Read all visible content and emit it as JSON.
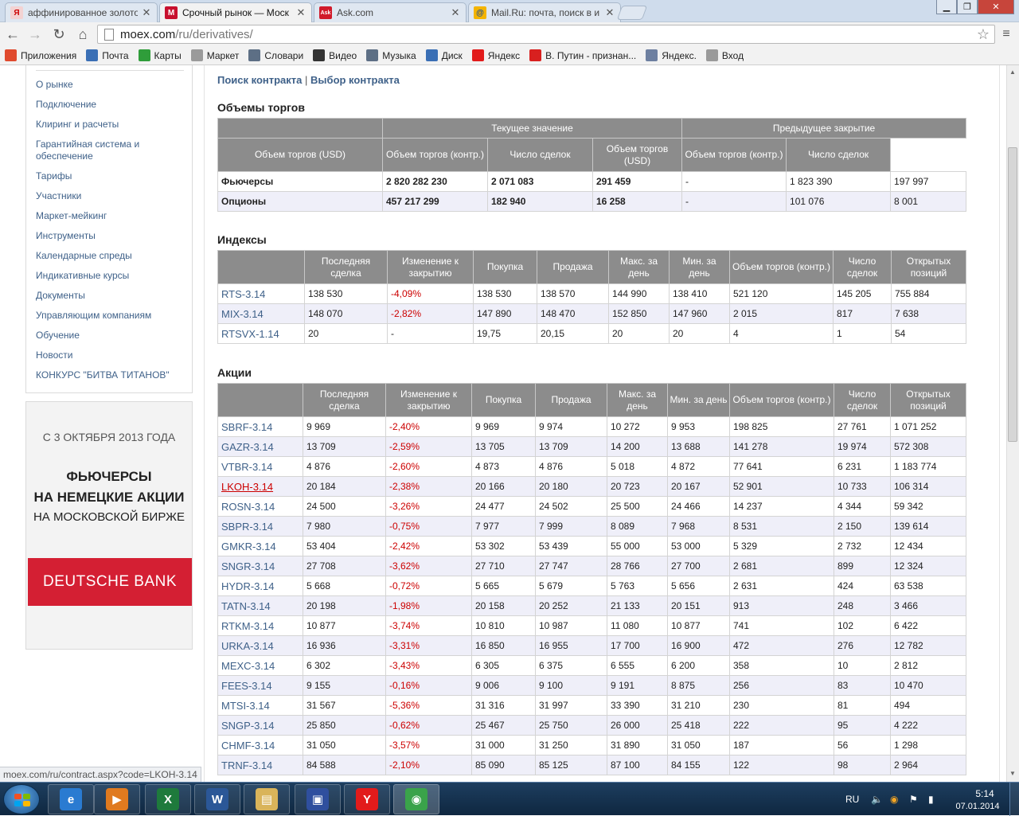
{
  "browser": {
    "tabs": [
      {
        "title": "аффинированное золото",
        "icon_text": "Я",
        "icon_color": "#e8c4c4"
      },
      {
        "title": "Срочный рынок — Моск",
        "icon_text": "М",
        "icon_color": "#c8102e"
      },
      {
        "title": "Ask.com",
        "icon_text": "Ask",
        "icon_color": "#d11a2a"
      },
      {
        "title": "Mail.Ru: почта, поиск в и",
        "icon_text": "@",
        "icon_color": "#1f6fb8"
      }
    ],
    "url_host": "moex.com",
    "url_path": "/ru/derivatives/",
    "bookmarks": [
      {
        "label": "Приложения",
        "icon": "apps-grid-icon",
        "color": "#e04a2e"
      },
      {
        "label": "Почта",
        "icon": "mail-icon",
        "color": "#3a6fb5"
      },
      {
        "label": "Карты",
        "icon": "maps-icon",
        "color": "#2f9d3a"
      },
      {
        "label": "Маркет",
        "icon": "page-icon",
        "color": "#9a9a9a"
      },
      {
        "label": "Словари",
        "icon": "dictionary-icon",
        "color": "#5d6f85"
      },
      {
        "label": "Видео",
        "icon": "video-icon",
        "color": "#333333"
      },
      {
        "label": "Музыка",
        "icon": "music-icon",
        "color": "#5d6f85"
      },
      {
        "label": "Диск",
        "icon": "disk-icon",
        "color": "#3a6fb5"
      },
      {
        "label": "Яндекс",
        "icon": "yandex-icon",
        "color": "#e21b1b"
      },
      {
        "label": "В. Путин - признан...",
        "icon": "youtube-icon",
        "color": "#d8201f"
      },
      {
        "label": "Яндекс.",
        "icon": "page-icon",
        "color": "#6d7fa0"
      },
      {
        "label": "Вход",
        "icon": "page-icon",
        "color": "#9a9a9a"
      }
    ]
  },
  "sidebar": {
    "items": [
      "О рынке",
      "Подключение",
      "Клиринг и расчеты",
      "Гарантийная система и обеспечение",
      "Тарифы",
      "Участники",
      "Маркет-мейкинг",
      "Инструменты",
      "Календарные спреды",
      "Индикативные курсы",
      "Документы",
      "Управляющим компаниям",
      "Обучение",
      "Новости",
      "КОНКУРС \"БИТВА ТИТАНОВ\""
    ]
  },
  "banner": {
    "date": "С 3 ОКТЯБРЯ 2013 ГОДА",
    "line1": "ФЬЮЧЕРСЫ",
    "line2": "НА НЕМЕЦКИЕ АКЦИИ",
    "line3": "НА МОСКОВСКОЙ БИРЖЕ",
    "bank": "DEUTSCHE BANK"
  },
  "top_links": {
    "search": "Поиск контракта",
    "separator": "|",
    "choose": "Выбор контракта"
  },
  "volumes": {
    "title": "Объемы торгов",
    "group_current": "Текущее значение",
    "group_previous": "Предыдущее закрытие",
    "columns": [
      "Объем торгов (USD)",
      "Объем торгов (контр.)",
      "Число сделок",
      "Объем торгов (USD)",
      "Объем торгов (контр.)",
      "Число сделок"
    ],
    "rows": [
      [
        "Фьючерсы",
        "2 820 282 230",
        "2 071 083",
        "291 459",
        "-",
        "1 823 390",
        "197 997"
      ],
      [
        "Опционы",
        "457 217 299",
        "182 940",
        "16 258",
        "-",
        "101 076",
        "8 001"
      ]
    ]
  },
  "indices": {
    "title": "Индексы",
    "columns": [
      "",
      "Последняя сделка",
      "Изменение к закрытию",
      "Покупка",
      "Продажа",
      "Макс. за день",
      "Мин. за день",
      "Объем торгов (контр.)",
      "Число сделок",
      "Открытых позиций"
    ],
    "rows": [
      [
        "RTS-3.14",
        "138 530",
        "-4,09%",
        "138 530",
        "138 570",
        "144 990",
        "138 410",
        "521 120",
        "145 205",
        "755 884"
      ],
      [
        "MIX-3.14",
        "148 070",
        "-2,82%",
        "147 890",
        "148 470",
        "152 850",
        "147 960",
        "2 015",
        "817",
        "7 638"
      ],
      [
        "RTSVX-1.14",
        "20",
        "-",
        "19,75",
        "20,15",
        "20",
        "20",
        "4",
        "1",
        "54"
      ]
    ]
  },
  "stocks": {
    "title": "Акции",
    "columns": [
      "",
      "Последняя сделка",
      "Изменение к закрытию",
      "Покупка",
      "Продажа",
      "Макс. за день",
      "Мин. за день",
      "Объем торгов (контр.)",
      "Число сделок",
      "Открытых позиций"
    ],
    "rows": [
      [
        "SBRF-3.14",
        "9 969",
        "-2,40%",
        "9 969",
        "9 974",
        "10 272",
        "9 953",
        "198 825",
        "27 761",
        "1 071 252"
      ],
      [
        "GAZR-3.14",
        "13 709",
        "-2,59%",
        "13 705",
        "13 709",
        "14 200",
        "13 688",
        "141 278",
        "19 974",
        "572 308"
      ],
      [
        "VTBR-3.14",
        "4 876",
        "-2,60%",
        "4 873",
        "4 876",
        "5 018",
        "4 872",
        "77 641",
        "6 231",
        "1 183 774"
      ],
      [
        "LKOH-3.14",
        "20 184",
        "-2,38%",
        "20 166",
        "20 180",
        "20 723",
        "20 167",
        "52 901",
        "10 733",
        "106 314"
      ],
      [
        "ROSN-3.14",
        "24 500",
        "-3,26%",
        "24 477",
        "24 502",
        "25 500",
        "24 466",
        "14 237",
        "4 344",
        "59 342"
      ],
      [
        "SBPR-3.14",
        "7 980",
        "-0,75%",
        "7 977",
        "7 999",
        "8 089",
        "7 968",
        "8 531",
        "2 150",
        "139 614"
      ],
      [
        "GMKR-3.14",
        "53 404",
        "-2,42%",
        "53 302",
        "53 439",
        "55 000",
        "53 000",
        "5 329",
        "2 732",
        "12 434"
      ],
      [
        "SNGR-3.14",
        "27 708",
        "-3,62%",
        "27 710",
        "27 747",
        "28 766",
        "27 700",
        "2 681",
        "899",
        "12 324"
      ],
      [
        "HYDR-3.14",
        "5 668",
        "-0,72%",
        "5 665",
        "5 679",
        "5 763",
        "5 656",
        "2 631",
        "424",
        "63 538"
      ],
      [
        "TATN-3.14",
        "20 198",
        "-1,98%",
        "20 158",
        "20 252",
        "21 133",
        "20 151",
        "913",
        "248",
        "3 466"
      ],
      [
        "RTKM-3.14",
        "10 877",
        "-3,74%",
        "10 810",
        "10 987",
        "11 080",
        "10 877",
        "741",
        "102",
        "6 422"
      ],
      [
        "URKA-3.14",
        "16 936",
        "-3,31%",
        "16 850",
        "16 955",
        "17 700",
        "16 900",
        "472",
        "276",
        "12 782"
      ],
      [
        "MEXC-3.14",
        "6 302",
        "-3,43%",
        "6 305",
        "6 375",
        "6 555",
        "6 200",
        "358",
        "10",
        "2 812"
      ],
      [
        "FEES-3.14",
        "9 155",
        "-0,16%",
        "9 006",
        "9 100",
        "9 191",
        "8 875",
        "256",
        "83",
        "10 470"
      ],
      [
        "MTSI-3.14",
        "31 567",
        "-5,36%",
        "31 316",
        "31 997",
        "33 390",
        "31 210",
        "230",
        "81",
        "494"
      ],
      [
        "SNGP-3.14",
        "25 850",
        "-0,62%",
        "25 467",
        "25 750",
        "26 000",
        "25 418",
        "222",
        "95",
        "4 222"
      ],
      [
        "CHMF-3.14",
        "31 050",
        "-3,57%",
        "31 000",
        "31 250",
        "31 890",
        "31 050",
        "187",
        "56",
        "1 298"
      ],
      [
        "TRNF-3.14",
        "84 588",
        "-2,10%",
        "85 090",
        "85 125",
        "87 100",
        "84 155",
        "122",
        "98",
        "2 964"
      ]
    ],
    "hovered_symbol": "LKOH-3.14"
  },
  "status_url": "moex.com/ru/contract.aspx?code=LKOH-3.14",
  "taskbar": {
    "apps": [
      {
        "name": "internet-explorer",
        "glyph": "e",
        "color": "#2a7bd1"
      },
      {
        "name": "media-player",
        "glyph": "▶",
        "color": "#e07a1f"
      },
      {
        "name": "excel",
        "glyph": "X",
        "color": "#1e7a3c"
      },
      {
        "name": "word",
        "glyph": "W",
        "color": "#2b5797"
      },
      {
        "name": "file-explorer",
        "glyph": "▤",
        "color": "#d9b45a"
      },
      {
        "name": "save-app",
        "glyph": "▣",
        "color": "#2f4f9e"
      },
      {
        "name": "yandex-browser",
        "glyph": "Y",
        "color": "#e21b1b"
      },
      {
        "name": "chrome",
        "glyph": "◉",
        "color": "#3aa34a"
      }
    ],
    "lang": "RU",
    "time": "5:14",
    "date": "07.01.2014"
  },
  "colors": {
    "link": "#3f6189",
    "negative": "#cc0000",
    "header_bg": "#8c8c8c",
    "alt_row": "#efeff9"
  }
}
